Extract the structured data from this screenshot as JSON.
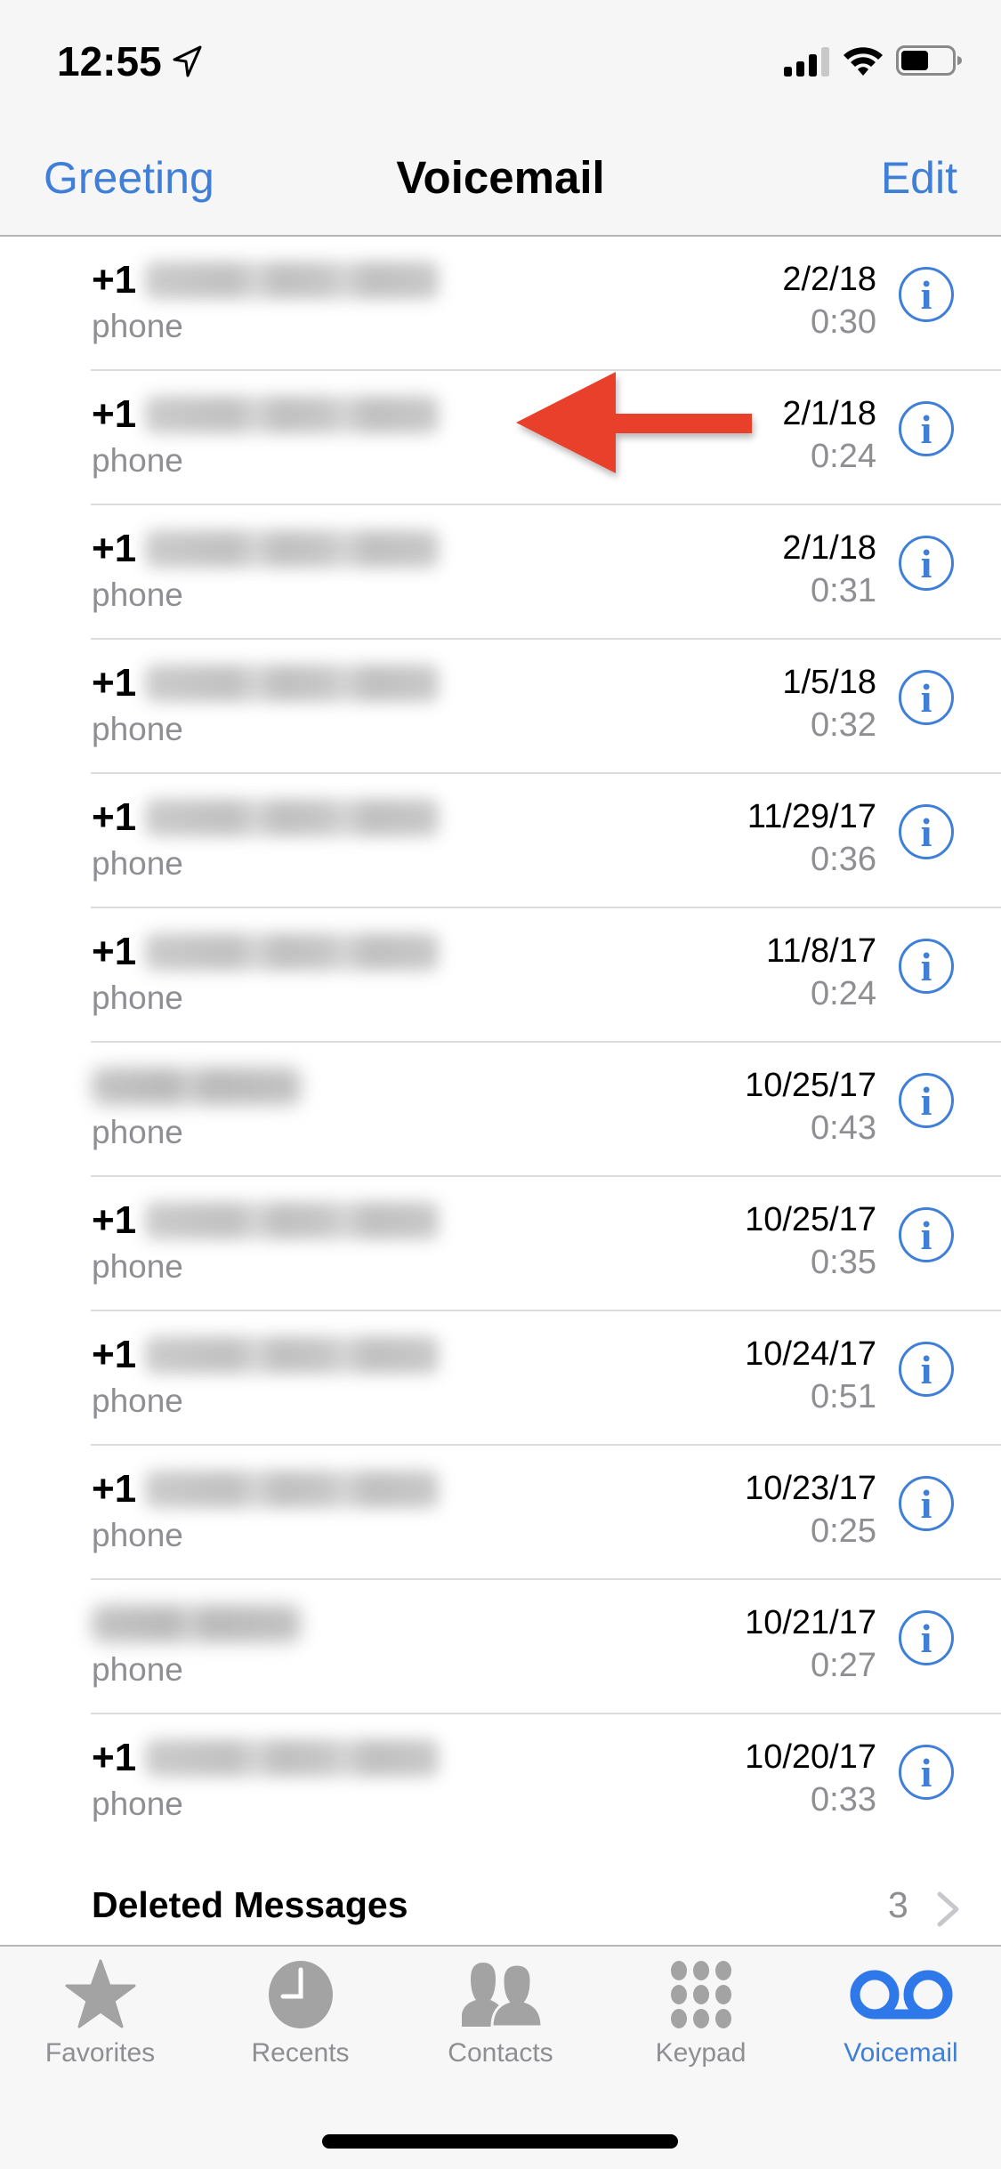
{
  "status_bar": {
    "time": "12:55",
    "icons": [
      "location-arrow-icon",
      "cellular-signal-icon",
      "wifi-icon",
      "battery-icon"
    ],
    "signal_bars_active": 3,
    "signal_bars_total": 4,
    "battery_level": 0.55
  },
  "nav": {
    "left_label": "Greeting",
    "title": "Voicemail",
    "right_label": "Edit"
  },
  "colors": {
    "accent": "#3f7fd8",
    "secondary_text": "#8e8e93",
    "annotation": "#e8412a"
  },
  "voicemails": [
    {
      "caller_prefix": "+1",
      "caller_redacted": true,
      "caller_type": "number",
      "label": "phone",
      "date": "2/2/18",
      "duration": "0:30"
    },
    {
      "caller_prefix": "+1",
      "caller_redacted": true,
      "caller_type": "number",
      "label": "phone",
      "date": "2/1/18",
      "duration": "0:24",
      "annotated": true
    },
    {
      "caller_prefix": "+1",
      "caller_redacted": true,
      "caller_type": "number",
      "label": "phone",
      "date": "2/1/18",
      "duration": "0:31"
    },
    {
      "caller_prefix": "+1",
      "caller_redacted": true,
      "caller_type": "number",
      "label": "phone",
      "date": "1/5/18",
      "duration": "0:32"
    },
    {
      "caller_prefix": "+1",
      "caller_redacted": true,
      "caller_type": "number",
      "label": "phone",
      "date": "11/29/17",
      "duration": "0:36"
    },
    {
      "caller_prefix": "+1",
      "caller_redacted": true,
      "caller_type": "number",
      "label": "phone",
      "date": "11/8/17",
      "duration": "0:24"
    },
    {
      "caller_prefix": "",
      "caller_redacted": true,
      "caller_type": "name",
      "label": "phone",
      "date": "10/25/17",
      "duration": "0:43"
    },
    {
      "caller_prefix": "+1",
      "caller_redacted": true,
      "caller_type": "number",
      "label": "phone",
      "date": "10/25/17",
      "duration": "0:35"
    },
    {
      "caller_prefix": "+1",
      "caller_redacted": true,
      "caller_type": "number",
      "label": "phone",
      "date": "10/24/17",
      "duration": "0:51"
    },
    {
      "caller_prefix": "+1",
      "caller_redacted": true,
      "caller_type": "number",
      "label": "phone",
      "date": "10/23/17",
      "duration": "0:25"
    },
    {
      "caller_prefix": "",
      "caller_redacted": true,
      "caller_type": "name",
      "label": "phone",
      "date": "10/21/17",
      "duration": "0:27"
    },
    {
      "caller_prefix": "+1",
      "caller_redacted": true,
      "caller_type": "number",
      "label": "phone",
      "date": "10/20/17",
      "duration": "0:33"
    }
  ],
  "deleted_messages": {
    "label": "Deleted Messages",
    "count": "3"
  },
  "tabs": [
    {
      "label": "Favorites",
      "icon": "star-icon",
      "active": false
    },
    {
      "label": "Recents",
      "icon": "clock-icon",
      "active": false
    },
    {
      "label": "Contacts",
      "icon": "contacts-icon",
      "active": false
    },
    {
      "label": "Keypad",
      "icon": "keypad-icon",
      "active": false
    },
    {
      "label": "Voicemail",
      "icon": "voicemail-icon",
      "active": true
    }
  ]
}
